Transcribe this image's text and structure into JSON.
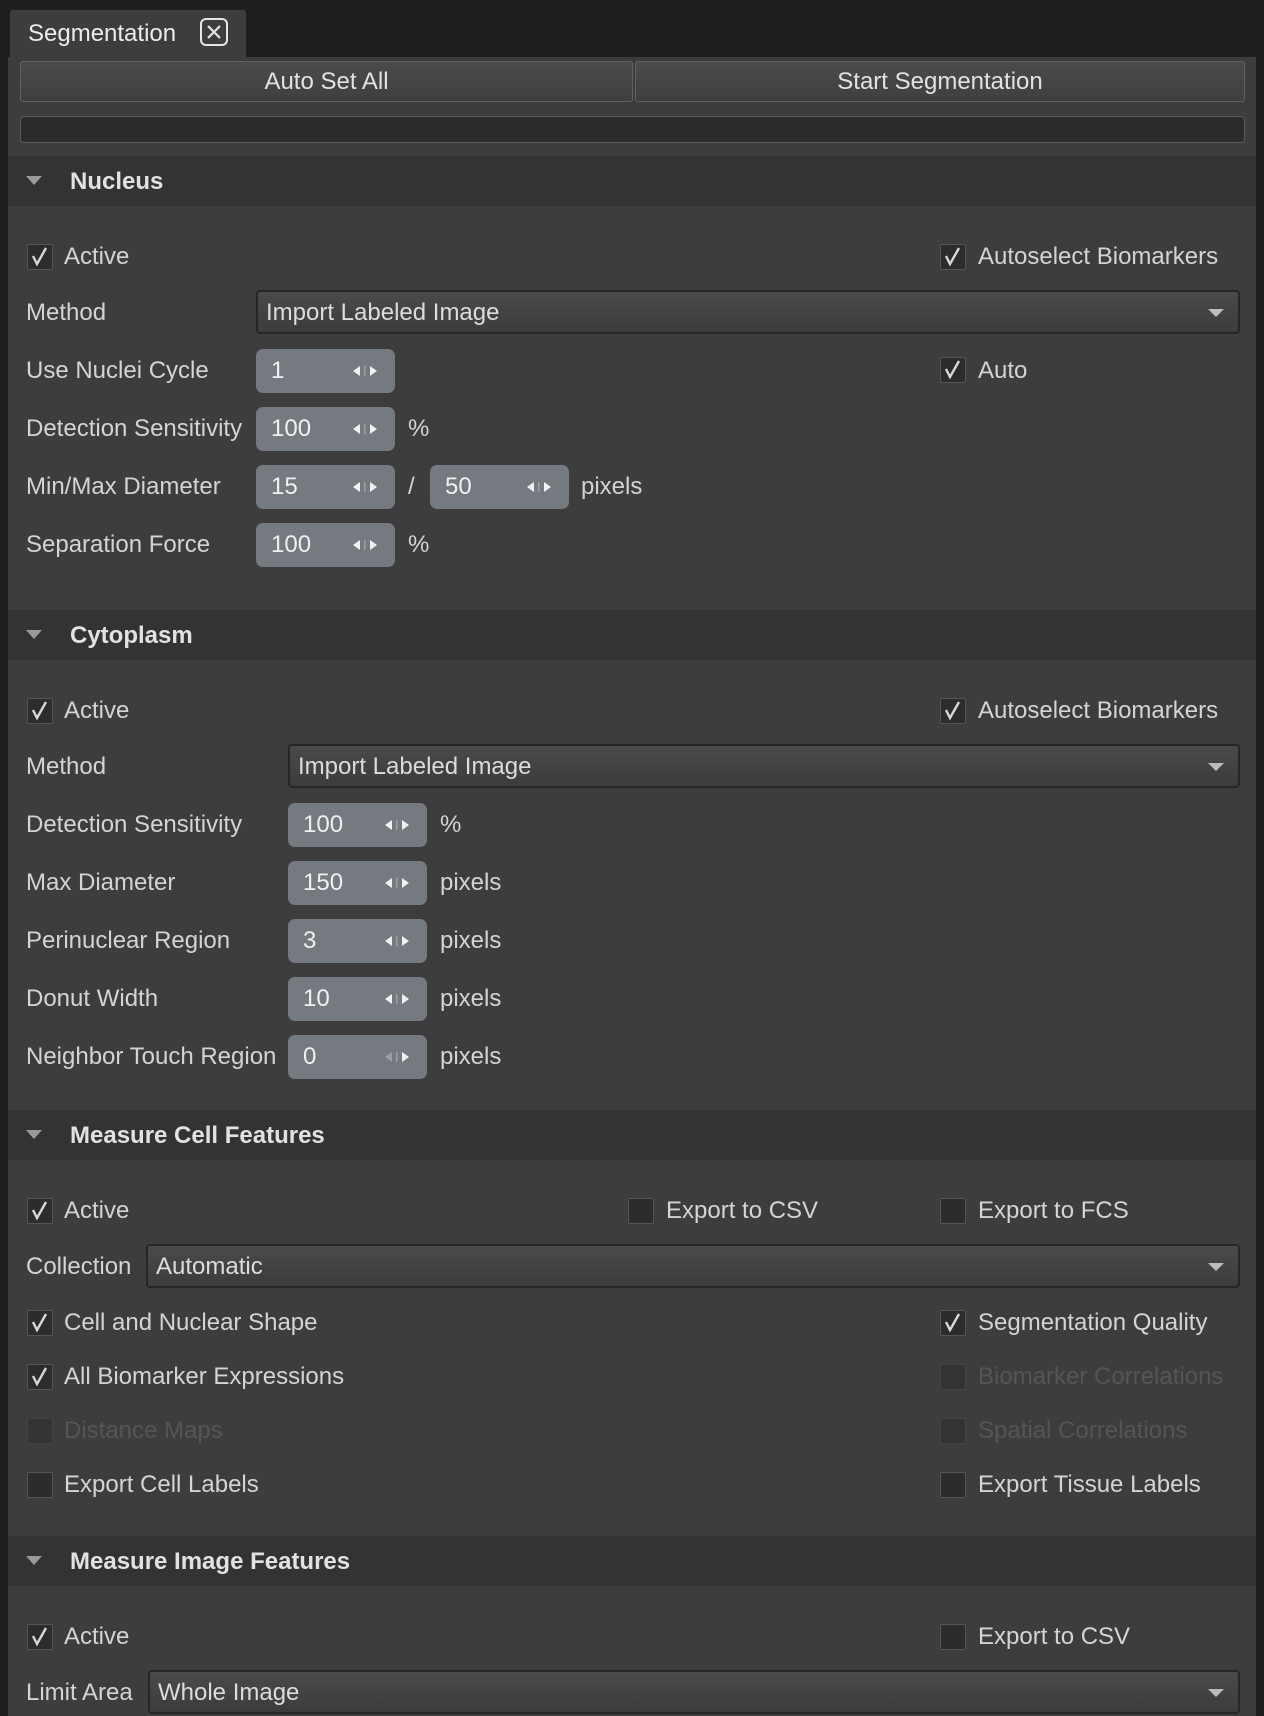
{
  "tab": {
    "label": "Segmentation"
  },
  "toolbar": {
    "auto_set_all": "Auto Set All",
    "start_segmentation": "Start Segmentation"
  },
  "nucleus": {
    "title": "Nucleus",
    "active": {
      "label": "Active",
      "checked": true
    },
    "autoselect": {
      "label": "Autoselect Biomarkers",
      "checked": true
    },
    "method_label": "Method",
    "method_value": "Import Labeled Image",
    "cycle_label": "Use Nuclei Cycle",
    "cycle_value": "1",
    "auto": {
      "label": "Auto",
      "checked": true
    },
    "sensitivity_label": "Detection Sensitivity",
    "sensitivity_value": "100",
    "sensitivity_unit": "%",
    "diameter_label": "Min/Max Diameter",
    "min_diameter": "15",
    "separator": "/",
    "max_diameter": "50",
    "diameter_unit": "pixels",
    "separation_label": "Separation Force",
    "separation_value": "100",
    "separation_unit": "%"
  },
  "cytoplasm": {
    "title": "Cytoplasm",
    "active": {
      "label": "Active",
      "checked": true
    },
    "autoselect": {
      "label": "Autoselect Biomarkers",
      "checked": true
    },
    "method_label": "Method",
    "method_value": "Import Labeled Image",
    "sensitivity_label": "Detection Sensitivity",
    "sensitivity_value": "100",
    "sensitivity_unit": "%",
    "max_diameter_label": "Max Diameter",
    "max_diameter_value": "150",
    "max_diameter_unit": "pixels",
    "perinuclear_label": "Perinuclear Region",
    "perinuclear_value": "3",
    "perinuclear_unit": "pixels",
    "donut_label": "Donut Width",
    "donut_value": "10",
    "donut_unit": "pixels",
    "neighbor_label": "Neighbor Touch Region",
    "neighbor_value": "0",
    "neighbor_unit": "pixels"
  },
  "cell_features": {
    "title": "Measure Cell Features",
    "active": {
      "label": "Active",
      "checked": true
    },
    "export_csv": {
      "label": "Export to CSV",
      "checked": false
    },
    "export_fcs": {
      "label": "Export to FCS",
      "checked": false
    },
    "collection_label": "Collection",
    "collection_value": "Automatic",
    "shape": {
      "label": "Cell and Nuclear Shape",
      "checked": true
    },
    "seg_quality": {
      "label": "Segmentation Quality",
      "checked": true
    },
    "biomarker_expr": {
      "label": "All Biomarker Expressions",
      "checked": true
    },
    "biomarker_corr": {
      "label": "Biomarker Correlations",
      "checked": false,
      "disabled": true
    },
    "distance_maps": {
      "label": "Distance Maps",
      "checked": false,
      "disabled": true
    },
    "spatial_corr": {
      "label": "Spatial Correlations",
      "checked": false,
      "disabled": true
    },
    "export_cell_labels": {
      "label": "Export Cell Labels",
      "checked": false
    },
    "export_tissue_labels": {
      "label": "Export Tissue Labels",
      "checked": false
    }
  },
  "image_features": {
    "title": "Measure Image Features",
    "active": {
      "label": "Active",
      "checked": true
    },
    "export_csv": {
      "label": "Export to CSV",
      "checked": false
    },
    "limit_label": "Limit Area",
    "limit_value": "Whole Image"
  },
  "colors": {
    "panel_bg": "#3d3d3d",
    "header_bg": "#333333",
    "spin_bg": "#757a80",
    "text": "#d4d4d4",
    "disabled_text": "#555555"
  }
}
